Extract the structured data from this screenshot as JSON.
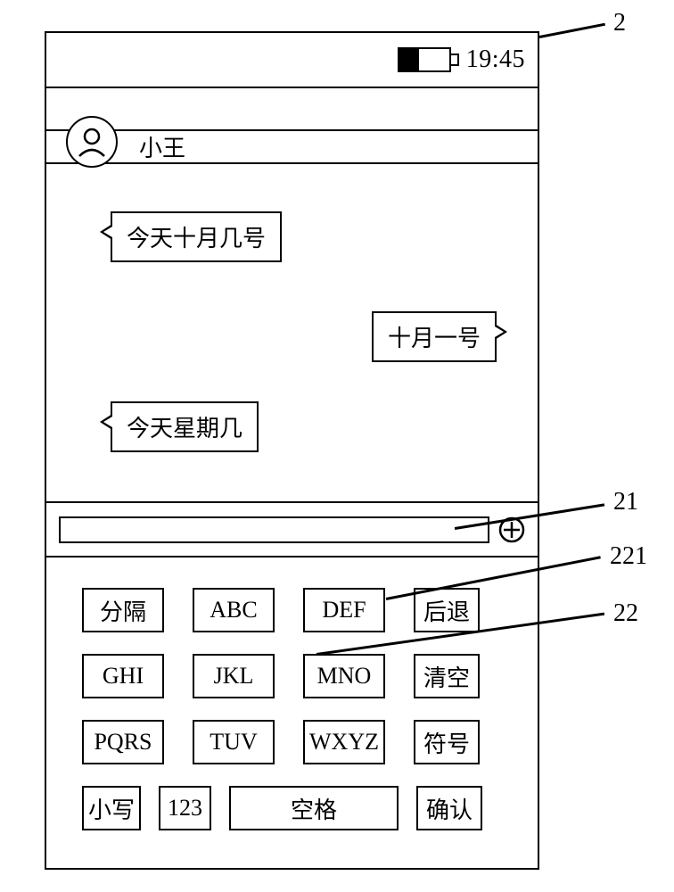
{
  "status": {
    "time": "19:45"
  },
  "contact": {
    "name": "小王"
  },
  "chat": {
    "msg1": "今天十月几号",
    "msg2": "十月一号",
    "msg3": "今天星期几"
  },
  "keyboard": {
    "row1": {
      "k1": "分隔",
      "k2": "ABC",
      "k3": "DEF",
      "k4": "后退"
    },
    "row2": {
      "k1": "GHI",
      "k2": "JKL",
      "k3": "MNO",
      "k4": "清空"
    },
    "row3": {
      "k1": "PQRS",
      "k2": "TUV",
      "k3": "WXYZ",
      "k4": "符号"
    },
    "row4": {
      "k1": "小写",
      "k2": "123",
      "k3": "空格",
      "k4": "确认"
    }
  },
  "callouts": {
    "device": "2",
    "input_field": "21",
    "example_key": "221",
    "keyboard": "22"
  }
}
